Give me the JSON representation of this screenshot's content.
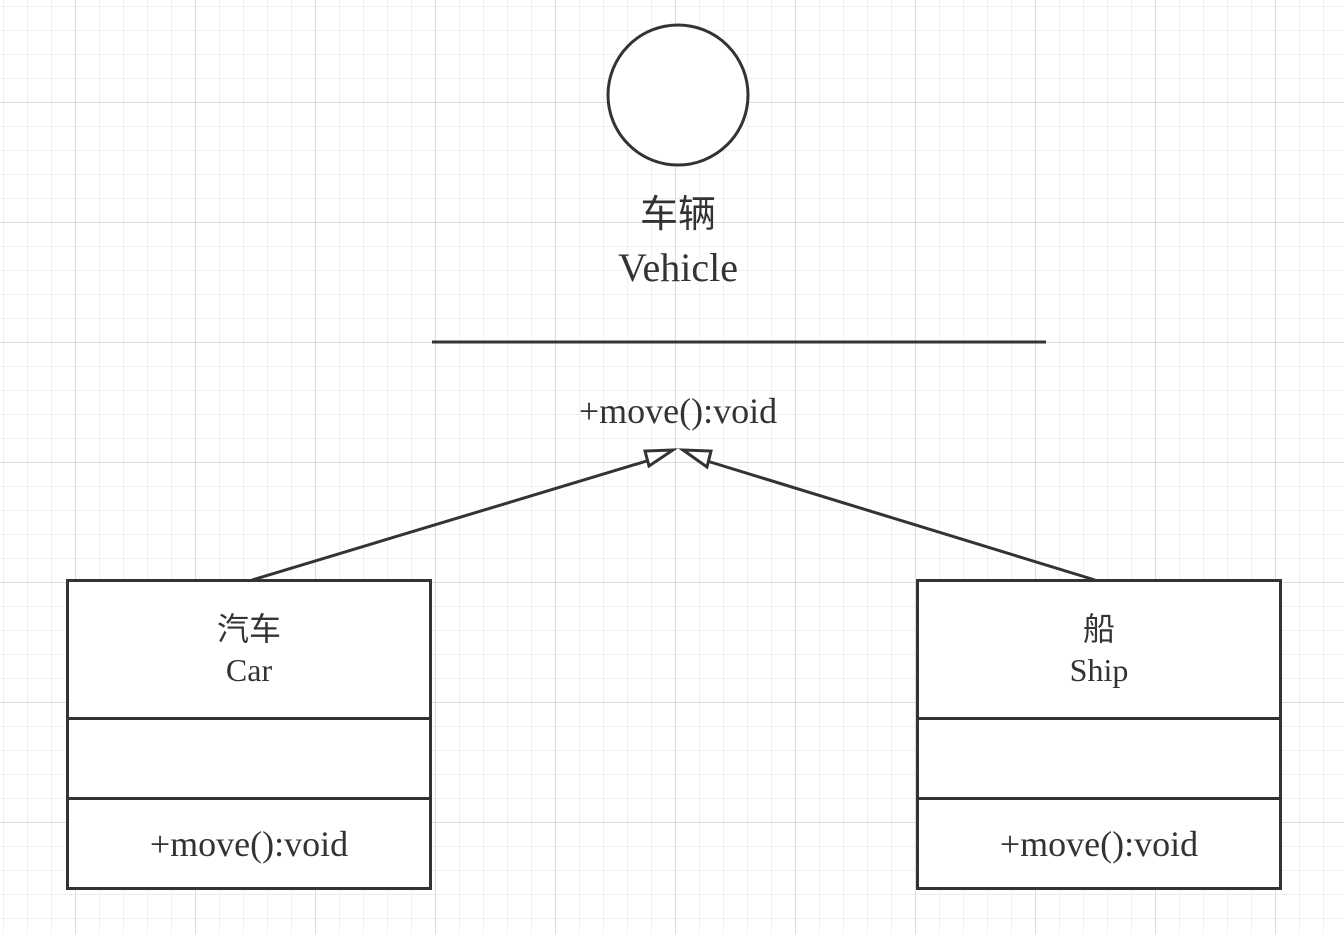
{
  "interface": {
    "name_cn": "车辆",
    "name_en": "Vehicle",
    "operation": "+move():void"
  },
  "classes": {
    "car": {
      "name_cn": "汽车",
      "name_en": "Car",
      "operation": "+move():void"
    },
    "ship": {
      "name_cn": "船",
      "name_en": "Ship",
      "operation": "+move():void"
    }
  },
  "relations": [
    {
      "from": "Car",
      "to": "Vehicle",
      "type": "realization"
    },
    {
      "from": "Ship",
      "to": "Vehicle",
      "type": "realization"
    }
  ],
  "colors": {
    "stroke": "#333333",
    "background": "#ffffff",
    "grid": "#dcdcdc"
  }
}
